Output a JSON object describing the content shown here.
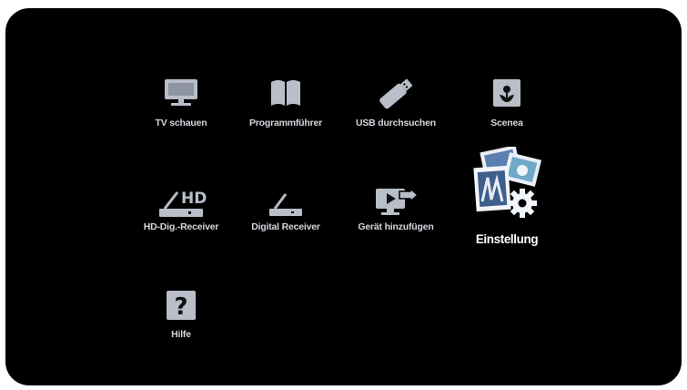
{
  "menu": {
    "items": [
      {
        "label": "TV schauen",
        "icon": "tv-icon"
      },
      {
        "label": "Programmführer",
        "icon": "book-icon"
      },
      {
        "label": "USB durchsuchen",
        "icon": "usb-stick-icon"
      },
      {
        "label": "Scenea",
        "icon": "flower-frame-icon"
      },
      {
        "label": "HD-Dig.-Receiver",
        "icon": "hd-receiver-icon",
        "badge": "HD"
      },
      {
        "label": "Digital Receiver",
        "icon": "receiver-icon"
      },
      {
        "label": "Gerät hinzufügen",
        "icon": "add-device-icon"
      },
      {
        "label": "Einstellung",
        "icon": "settings-photos-icon",
        "selected": true
      },
      {
        "label": "Hilfe",
        "icon": "help-icon",
        "glyph": "?"
      }
    ]
  },
  "colors": {
    "background": "#000000",
    "icon": "#b9bec9",
    "label": "#d4d6dd",
    "selected_label": "#ffffff"
  }
}
